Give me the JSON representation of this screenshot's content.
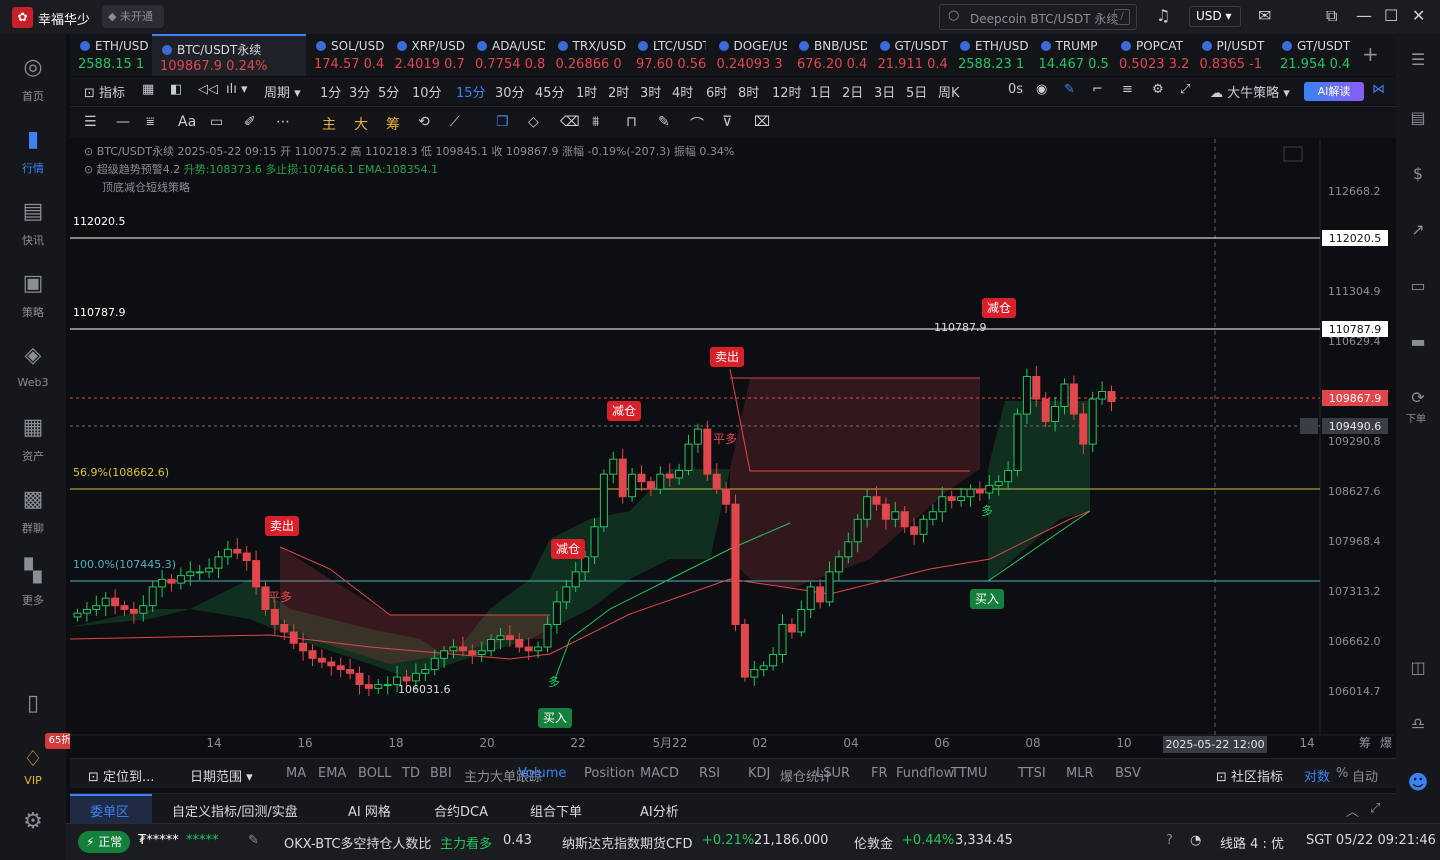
{
  "app": {
    "name": "幸福华少",
    "chip": "未开通"
  },
  "search": {
    "placeholder": "Deepcoin BTC/USDT 永续",
    "shortcut": "/"
  },
  "currency": "USD",
  "sidebar": [
    {
      "label": "首页",
      "icon": "home-icon"
    },
    {
      "label": "行情",
      "icon": "chart-bars-icon",
      "active": true
    },
    {
      "label": "快讯",
      "icon": "news-icon"
    },
    {
      "label": "策略",
      "icon": "robot-icon"
    },
    {
      "label": "Web3",
      "icon": "web3-icon"
    },
    {
      "label": "资产",
      "icon": "wallet-icon"
    },
    {
      "label": "群聊",
      "icon": "chat-icon"
    },
    {
      "label": "更多",
      "icon": "grid-icon"
    }
  ],
  "vip": {
    "badge": "65折",
    "label": "VIP"
  },
  "tickers": [
    {
      "name": "ETH/USDT",
      "value": "2588.15 1",
      "up": true
    },
    {
      "name": "BTC/USDT永续",
      "value": "109867.9 0.24%",
      "up": false,
      "active": true
    },
    {
      "name": "SOL/USDT",
      "value": "174.57 0.4",
      "up": false
    },
    {
      "name": "XRP/USDT",
      "value": "2.4019 0.7",
      "up": false
    },
    {
      "name": "ADA/USDT",
      "value": "0.7754 0.8",
      "up": false
    },
    {
      "name": "TRX/USDT",
      "value": "0.26866 0",
      "up": false
    },
    {
      "name": "LTC/USDT",
      "value": "97.60 0.56",
      "up": false
    },
    {
      "name": "DOGE/USDT",
      "value": "0.24093 3",
      "up": false
    },
    {
      "name": "BNB/USDT",
      "value": "676.20 0.4",
      "up": false
    },
    {
      "name": "GT/USDT",
      "value": "21.911 0.4",
      "up": false
    },
    {
      "name": "ETH/USDT",
      "value": "2588.23 1",
      "up": true
    },
    {
      "name": "TRUMP",
      "value": "14.467 0.5",
      "up": true
    },
    {
      "name": "POPCAT",
      "value": "0.5023 3.2",
      "up": false
    },
    {
      "name": "PI/USDT",
      "value": "0.8365 -1",
      "up": false
    },
    {
      "name": "GT/USDT",
      "value": "21.954 0.4",
      "up": true
    }
  ],
  "timeframes": [
    "1分",
    "3分",
    "5分",
    "10分",
    "15分",
    "30分",
    "45分",
    "1时",
    "2时",
    "3时",
    "4时",
    "6时",
    "8时",
    "12时",
    "1日",
    "2日",
    "3日",
    "5日",
    "周K"
  ],
  "selected_tf": "15分",
  "toolbar": {
    "indicators": "指标",
    "period": "周期",
    "countdown": "0s",
    "bull": "大牛策略",
    "ai": "AI解读"
  },
  "draw_labels": {
    "main": "主",
    "big": "大",
    "chips": "筹"
  },
  "chart_info": {
    "line1": "BTC/USDT永续 2025-05-22 09:15 开 110075.2 高 110218.3 低 109845.1 收 109867.9 涨幅 -0.19%(-207.3) 振幅 0.34%",
    "line2a": "超级趋势预警4.2",
    "line2b": "升势:108373.6 多止损:107466.1 EMA:108354.1",
    "line3": "顶底减仓短线策略"
  },
  "price_axis": [
    "112668.2",
    "111304.9",
    "110629.4",
    "109290.8",
    "108627.6",
    "107968.4",
    "107313.2",
    "106662.0",
    "106014.7"
  ],
  "price_tags": {
    "h1": "112020.5",
    "h2": "110787.9",
    "last": "109867.9",
    "cross": "109490.6"
  },
  "levels": {
    "top": "112020.5",
    "second": "110787.9",
    "fib56": "56.9%(108662.6)",
    "fib100": "100.0%(107445.3)"
  },
  "signals": {
    "sell1": "卖出",
    "sell2": "卖出",
    "reduce1": "减仓",
    "reduce2": "减仓",
    "reduce3": "减仓",
    "buy1": "买入",
    "buy2": "买入",
    "flat1": "平多",
    "flat2": "平多",
    "long1": "多",
    "long2": "多"
  },
  "annotations": {
    "low": "106031.6",
    "high": "110787.9"
  },
  "x_axis": [
    "14",
    "16",
    "18",
    "20",
    "22",
    "5月22",
    "02",
    "04",
    "06",
    "08",
    "10",
    "14"
  ],
  "crosshair_time": "2025-05-22 12:00",
  "x_axis_right": {
    "a": "筹",
    "b": "爆"
  },
  "indicator_bar": {
    "locate": "定位到...",
    "range": "日期范围",
    "items": [
      "MA",
      "EMA",
      "BOLL",
      "TD",
      "BBI",
      "主力大单跟踪",
      "Volume",
      "Position",
      "MACD",
      "RSI",
      "KDJ",
      "爆仓统计",
      "LSUR",
      "FR",
      "Fundflow",
      "TTMU",
      "TTSI",
      "MLR",
      "BSV"
    ],
    "selected": "Volume",
    "community": "社区指标",
    "compare": "对数",
    "pct": "%",
    "auto": "自动"
  },
  "tabs": [
    "委单区",
    "自定义指标/回测/实盘",
    "AI 网格",
    "合约DCA",
    "组合下单",
    "AI分析"
  ],
  "status": {
    "state": "正常",
    "user": "₮*****",
    "mask": "*****",
    "ratio_label": "OKX-BTC多空持仓人数比",
    "ratio_tag": "主力看多",
    "ratio_val": "0.43",
    "nasdaq": "纳斯达克指数期货CFD",
    "nasdaq_chg": "+0.21%",
    "nasdaq_val": "21,186.000",
    "gold": "伦敦金",
    "gold_chg": "+0.44%",
    "gold_val": "3,334.45",
    "line": "线路 4 : 优",
    "time": "SGT 05/22 09:21:46"
  },
  "colors": {
    "up": "#22c55e",
    "down": "#e0474c",
    "accent": "#3b82f6"
  },
  "chart_data": {
    "type": "candlestick",
    "symbol": "BTC/USDT永续",
    "interval": "15分",
    "y_ticks": [
      112668.2,
      111304.9,
      110629.4,
      109290.8,
      108627.6,
      107968.4,
      107313.2,
      106662.0,
      106014.7
    ],
    "levels": [
      112020.5,
      110787.9,
      108662.6,
      107445.3
    ],
    "last": 109867.9,
    "low": 106031.6,
    "high": 110787.9
  }
}
